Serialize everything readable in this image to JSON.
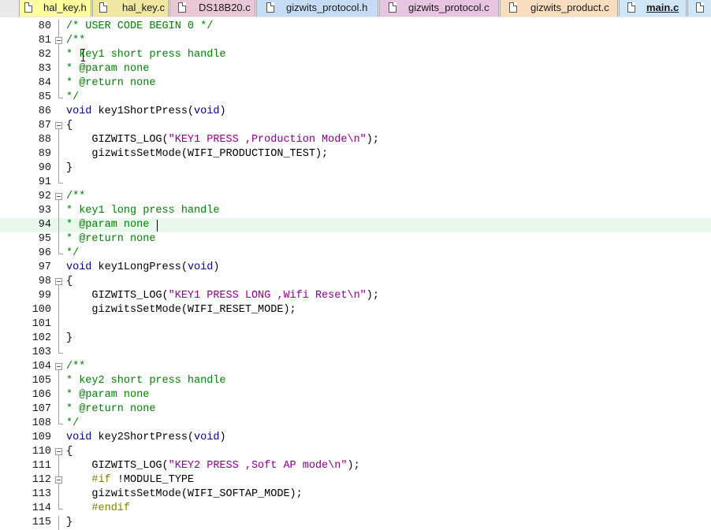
{
  "tabs": [
    {
      "label": "hal_key.h",
      "color": "#ffff9e",
      "active": false
    },
    {
      "label": "hal_key.c",
      "color": "#f0e7a0",
      "active": false
    },
    {
      "label": "DS18B20.c",
      "color": "#e9c7d6",
      "active": false
    },
    {
      "label": "gizwits_protocol.h",
      "color": "#c6dcf5",
      "active": false
    },
    {
      "label": "gizwits_protocol.c",
      "color": "#e7c4e0",
      "active": false
    },
    {
      "label": "gizwits_product.c",
      "color": "#f8ddbf",
      "active": false
    },
    {
      "label": "main.c",
      "color": "#cfe6f8",
      "active": true
    }
  ],
  "editor": {
    "current_line": 94,
    "lines": [
      {
        "n": "80",
        "fold": "line",
        "tokens": [
          {
            "t": "/* USER CODE BEGIN 0 */",
            "c": "cm"
          }
        ]
      },
      {
        "n": "81",
        "fold": "box",
        "tokens": [
          {
            "t": "/**",
            "c": "cm"
          }
        ]
      },
      {
        "n": "82",
        "fold": "line",
        "tokens": [
          {
            "t": "* key1 short press handle",
            "c": "cm"
          }
        ]
      },
      {
        "n": "83",
        "fold": "line",
        "tokens": [
          {
            "t": "* @param none",
            "c": "cm"
          }
        ]
      },
      {
        "n": "84",
        "fold": "line",
        "tokens": [
          {
            "t": "* @return none",
            "c": "cm"
          }
        ]
      },
      {
        "n": "85",
        "fold": "end",
        "tokens": [
          {
            "t": "*/",
            "c": "cm"
          }
        ]
      },
      {
        "n": "86",
        "fold": "",
        "tokens": [
          {
            "t": "void",
            "c": "kw"
          },
          {
            "t": " key1ShortPress(",
            "c": ""
          },
          {
            "t": "void",
            "c": "kw"
          },
          {
            "t": ")",
            "c": ""
          }
        ]
      },
      {
        "n": "87",
        "fold": "box",
        "tokens": [
          {
            "t": "{",
            "c": ""
          }
        ]
      },
      {
        "n": "88",
        "fold": "line",
        "tokens": [
          {
            "t": "    GIZWITS_LOG(",
            "c": ""
          },
          {
            "t": "\"KEY1 PRESS ,Production Mode\\n\"",
            "c": "str"
          },
          {
            "t": ");",
            "c": ""
          }
        ]
      },
      {
        "n": "89",
        "fold": "line",
        "tokens": [
          {
            "t": "    gizwitsSetMode(WIFI_PRODUCTION_TEST);",
            "c": ""
          }
        ]
      },
      {
        "n": "90",
        "fold": "line",
        "tokens": [
          {
            "t": "}",
            "c": ""
          }
        ]
      },
      {
        "n": "91",
        "fold": "end",
        "tokens": []
      },
      {
        "n": "92",
        "fold": "box",
        "tokens": [
          {
            "t": "/**",
            "c": "cm"
          }
        ]
      },
      {
        "n": "93",
        "fold": "line",
        "tokens": [
          {
            "t": "* key1 long press handle",
            "c": "cm"
          }
        ]
      },
      {
        "n": "94",
        "fold": "line",
        "tokens": [
          {
            "t": "* @param none",
            "c": "cm"
          }
        ]
      },
      {
        "n": "95",
        "fold": "line",
        "tokens": [
          {
            "t": "* @return none",
            "c": "cm"
          }
        ]
      },
      {
        "n": "96",
        "fold": "end",
        "tokens": [
          {
            "t": "*/",
            "c": "cm"
          }
        ]
      },
      {
        "n": "97",
        "fold": "",
        "tokens": [
          {
            "t": "void",
            "c": "kw"
          },
          {
            "t": " key1LongPress(",
            "c": ""
          },
          {
            "t": "void",
            "c": "kw"
          },
          {
            "t": ")",
            "c": ""
          }
        ]
      },
      {
        "n": "98",
        "fold": "box",
        "tokens": [
          {
            "t": "{",
            "c": ""
          }
        ]
      },
      {
        "n": "99",
        "fold": "line",
        "tokens": [
          {
            "t": "    GIZWITS_LOG(",
            "c": ""
          },
          {
            "t": "\"KEY1 PRESS LONG ,Wifi Reset\\n\"",
            "c": "str"
          },
          {
            "t": ");",
            "c": ""
          }
        ]
      },
      {
        "n": "100",
        "fold": "line",
        "tokens": [
          {
            "t": "    gizwitsSetMode(WIFI_RESET_MODE);",
            "c": ""
          }
        ]
      },
      {
        "n": "101",
        "fold": "line",
        "tokens": []
      },
      {
        "n": "102",
        "fold": "line",
        "tokens": [
          {
            "t": "}",
            "c": ""
          }
        ]
      },
      {
        "n": "103",
        "fold": "end",
        "tokens": []
      },
      {
        "n": "104",
        "fold": "box",
        "tokens": [
          {
            "t": "/**",
            "c": "cm"
          }
        ]
      },
      {
        "n": "105",
        "fold": "line",
        "tokens": [
          {
            "t": "* key2 short press handle",
            "c": "cm"
          }
        ]
      },
      {
        "n": "106",
        "fold": "line",
        "tokens": [
          {
            "t": "* @param none",
            "c": "cm"
          }
        ]
      },
      {
        "n": "107",
        "fold": "line",
        "tokens": [
          {
            "t": "* @return none",
            "c": "cm"
          }
        ]
      },
      {
        "n": "108",
        "fold": "end",
        "tokens": [
          {
            "t": "*/",
            "c": "cm"
          }
        ]
      },
      {
        "n": "109",
        "fold": "",
        "tokens": [
          {
            "t": "void",
            "c": "kw"
          },
          {
            "t": " key2ShortPress(",
            "c": ""
          },
          {
            "t": "void",
            "c": "kw"
          },
          {
            "t": ")",
            "c": ""
          }
        ]
      },
      {
        "n": "110",
        "fold": "box",
        "tokens": [
          {
            "t": "{",
            "c": ""
          }
        ]
      },
      {
        "n": "111",
        "fold": "line",
        "tokens": [
          {
            "t": "    GIZWITS_LOG(",
            "c": ""
          },
          {
            "t": "\"KEY2 PRESS ,Soft AP mode\\n\"",
            "c": "str"
          },
          {
            "t": ");",
            "c": ""
          }
        ]
      },
      {
        "n": "112",
        "fold": "box",
        "tokens": [
          {
            "t": "    #if",
            "c": "pp"
          },
          {
            "t": " !MODULE_TYPE",
            "c": ""
          }
        ]
      },
      {
        "n": "113",
        "fold": "line",
        "tokens": [
          {
            "t": "    gizwitsSetMode(WIFI_SOFTAP_MODE);",
            "c": ""
          }
        ]
      },
      {
        "n": "114",
        "fold": "end",
        "tokens": [
          {
            "t": "    #endif",
            "c": "pp"
          }
        ]
      },
      {
        "n": "115",
        "fold": "line",
        "tokens": [
          {
            "t": "}",
            "c": ""
          }
        ]
      }
    ]
  }
}
